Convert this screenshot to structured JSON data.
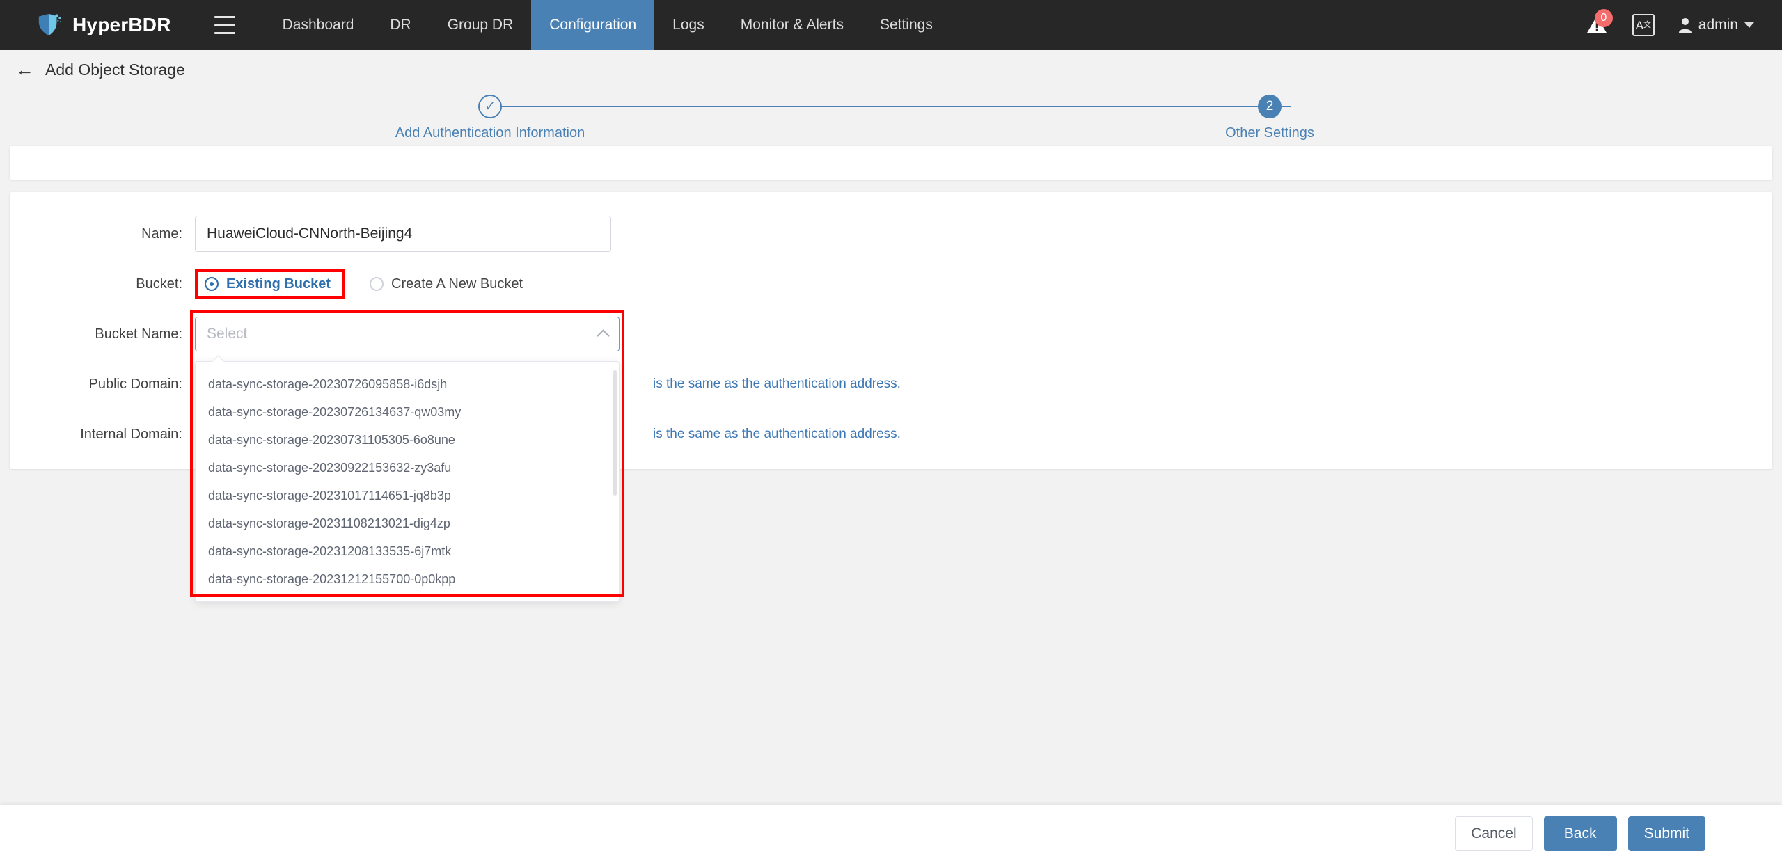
{
  "navbar": {
    "brand": "HyperBDR",
    "menu_icon": "hamburger-icon",
    "items": [
      {
        "label": "Dashboard",
        "active": false
      },
      {
        "label": "DR",
        "active": false
      },
      {
        "label": "Group DR",
        "active": false
      },
      {
        "label": "Configuration",
        "active": true
      },
      {
        "label": "Logs",
        "active": false
      },
      {
        "label": "Monitor & Alerts",
        "active": false
      },
      {
        "label": "Settings",
        "active": false
      }
    ],
    "alert_badge": "0",
    "lang_icon_main": "A",
    "lang_icon_sup": "文",
    "user": "admin",
    "accent": "#4a81b5",
    "badge_color": "#f56c6c",
    "background": "#272727"
  },
  "page": {
    "back_arrow": "←",
    "title": "Add Object Storage"
  },
  "stepper": {
    "steps": [
      {
        "marker": "✓",
        "label": "Add Authentication Information",
        "state": "done"
      },
      {
        "marker": "2",
        "label": "Other Settings",
        "state": "current"
      }
    ],
    "line_color": "#4a81b5"
  },
  "form": {
    "name": {
      "label": "Name:",
      "value": "HuaweiCloud-CNNorth-Beijing4"
    },
    "bucket": {
      "label": "Bucket:",
      "options": [
        {
          "label": "Existing Bucket",
          "selected": true,
          "highlighted": true
        },
        {
          "label": "Create A New Bucket",
          "selected": false,
          "highlighted": false
        }
      ]
    },
    "bucket_name": {
      "label": "Bucket Name:",
      "placeholder": "Select",
      "value": "",
      "expanded": true,
      "highlight_color": "#ff0000",
      "options": [
        "data-sync-storage-20230726095858-i6dsjh",
        "data-sync-storage-20230726134637-qw03my",
        "data-sync-storage-20230731105305-6o8une",
        "data-sync-storage-20230922153632-zy3afu",
        "data-sync-storage-20231017114651-jq8b3p",
        "data-sync-storage-20231108213021-dig4zp",
        "data-sync-storage-20231208133535-6j7mtk",
        "data-sync-storage-20231212155700-0p0kpp"
      ]
    },
    "public_domain": {
      "label": "Public Domain:",
      "hint": "is the same as the authentication address."
    },
    "internal_domain": {
      "label": "Internal Domain:",
      "hint": "is the same as the authentication address."
    }
  },
  "footer": {
    "cancel": "Cancel",
    "back": "Back",
    "submit": "Submit"
  }
}
